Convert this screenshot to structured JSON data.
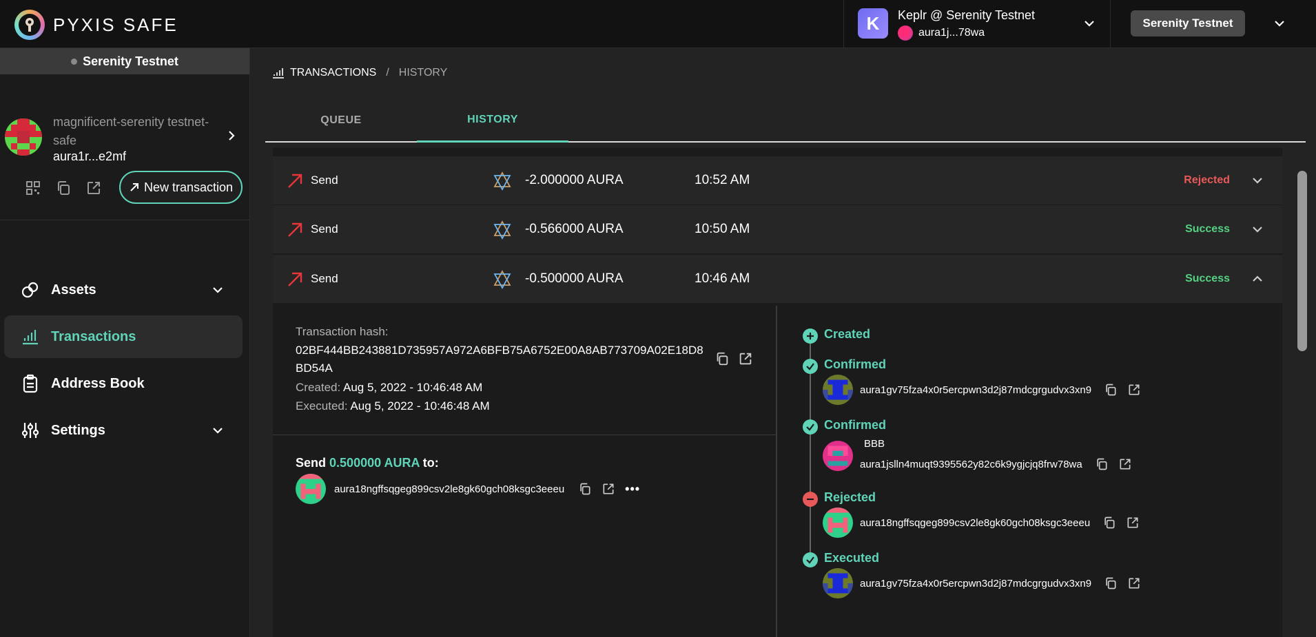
{
  "app": {
    "title": "PYXIS SAFE"
  },
  "wallet": {
    "name": "Keplr @ Serenity Testnet",
    "address": "aura1j...78wa",
    "badge": "K"
  },
  "network": {
    "button": "Serenity Testnet",
    "strip": "Serenity Testnet"
  },
  "safe": {
    "name": "magnificent-serenity testnet-safe",
    "address": "aura1r...e2mf",
    "new_tx": "New transaction"
  },
  "nav": {
    "assets": "Assets",
    "transactions": "Transactions",
    "address_book": "Address Book",
    "settings": "Settings"
  },
  "breadcrumb": {
    "section": "TRANSACTIONS",
    "separator": "/",
    "page": "HISTORY"
  },
  "tabs": {
    "queue": "QUEUE",
    "history": "HISTORY"
  },
  "transactions": [
    {
      "kind": "Send",
      "amount": "-2.000000 AURA",
      "time": "10:52 AM",
      "status": "Rejected"
    },
    {
      "kind": "Send",
      "amount": "-0.566000 AURA",
      "time": "10:50 AM",
      "status": "Success"
    },
    {
      "kind": "Send",
      "amount": "-0.500000 AURA",
      "time": "10:46 AM",
      "status": "Success"
    }
  ],
  "detail": {
    "hash_label": "Transaction hash:",
    "hash": "02BF444BB243881D735957A972A6BFB75A6752E00A8AB773709A02E18D8BD54A",
    "created_label": "Created:",
    "created": "Aug 5, 2022 - 10:46:48 AM",
    "executed_label": "Executed:",
    "executed": "Aug 5, 2022 - 10:46:48 AM",
    "send_prefix": "Send",
    "send_amount": "0.500000 AURA",
    "send_suffix": "to:",
    "recipient": "aura18ngffsqgeg899csv2le8gk60gch08ksgc3eeeu",
    "more": "•••"
  },
  "timeline": {
    "created": "Created",
    "confirmed1": "Confirmed",
    "confirmed1_addr": "aura1gv75fza4x0r5ercpwn3d2j87mdcgrgudvx3xn9",
    "confirmed2": "Confirmed",
    "confirmed2_name": "BBB",
    "confirmed2_addr": "aura1jslln4muqt9395562y82c6k9ygjcjq8frw78wa",
    "rejected": "Rejected",
    "rejected_addr": "aura18ngffsqgeg899csv2le8gk60gch08ksgc3eeeu",
    "executed": "Executed",
    "executed_addr": "aura1gv75fza4x0r5ercpwn3d2j87mdcgrgudvx3xn9"
  },
  "colors": {
    "accent": "#5fd4b8",
    "rejected": "#e8595a",
    "success": "#54d181",
    "send_arrow": "#e8353a"
  },
  "icons": [
    "pyxis-logo-icon",
    "chevron-down-icon",
    "chevron-right-icon",
    "qr-icon",
    "copy-icon",
    "external-link-icon",
    "arrow-up-right-icon",
    "assets-icon",
    "transactions-icon",
    "address-book-icon",
    "settings-icon",
    "aura-coin-icon",
    "chevron-up-icon",
    "plus-circle-icon",
    "check-circle-icon",
    "minus-circle-icon",
    "more-icon"
  ]
}
